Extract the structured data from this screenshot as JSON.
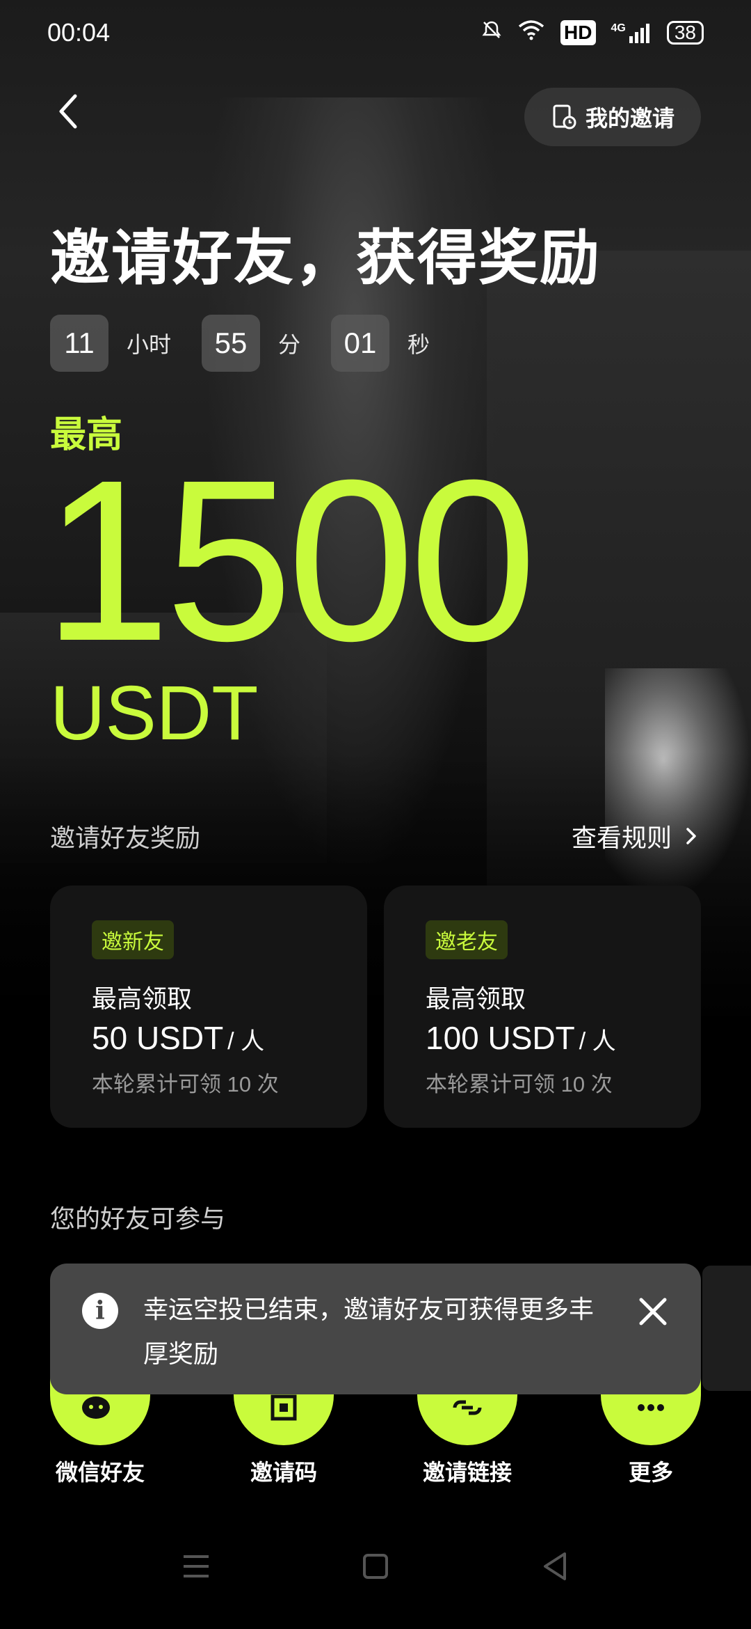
{
  "status_bar": {
    "time": "00:04",
    "network": "4G",
    "hd": "HD",
    "battery": "38"
  },
  "header": {
    "my_invites_label": "我的邀请"
  },
  "hero": {
    "title": "邀请好友，获得奖励",
    "countdown": {
      "hours": "11",
      "hours_unit": "小时",
      "minutes": "55",
      "minutes_unit": "分",
      "seconds": "01",
      "seconds_unit": "秒"
    },
    "max_label": "最高",
    "amount": "1500",
    "currency": "USDT"
  },
  "rewards": {
    "section_title": "邀请好友奖励",
    "rules_label": "查看规则",
    "cards": [
      {
        "tag": "邀新友",
        "line1": "最高领取",
        "amount": "50 USDT",
        "per": "/ 人",
        "note": "本轮累计可领 10 次"
      },
      {
        "tag": "邀老友",
        "line1": "最高领取",
        "amount": "100 USDT",
        "per": "/ 人",
        "note": "本轮累计可领 10 次"
      }
    ]
  },
  "friends": {
    "section_title": "您的好友可参与"
  },
  "share": {
    "items": [
      {
        "label": "微信好友",
        "icon": "wechat-icon"
      },
      {
        "label": "邀请码",
        "icon": "qrcode-icon"
      },
      {
        "label": "邀请链接",
        "icon": "link-icon"
      },
      {
        "label": "更多",
        "icon": "more-icon"
      }
    ]
  },
  "toast": {
    "message": "幸运空投已结束，邀请好友可获得更多丰厚奖励",
    "icon": "info-icon"
  },
  "colors": {
    "accent": "#c9fb3c",
    "background": "#000000",
    "card": "#151515",
    "toast": "#474747"
  }
}
